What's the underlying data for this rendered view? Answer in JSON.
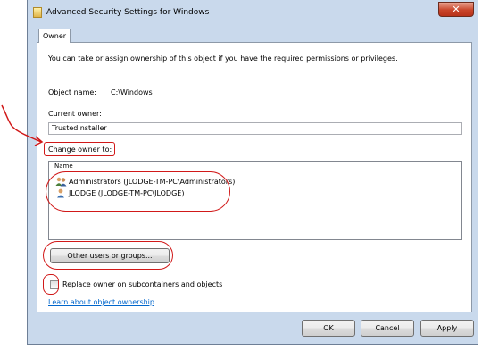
{
  "window": {
    "title": "Advanced Security Settings for Windows",
    "close_glyph": "✕"
  },
  "tabs": [
    {
      "label": "Owner"
    }
  ],
  "owner": {
    "intro": "You can take or assign ownership of this object if you have the required permissions or privileges.",
    "object_name_label": "Object name:",
    "object_name_value": "C:\\Windows",
    "current_owner_label": "Current owner:",
    "current_owner_value": "TrustedInstaller",
    "change_owner_label": "Change owner to:",
    "list_header": "Name",
    "list_items": [
      {
        "label": "Administrators (JLODGE-TM-PC\\Administrators)",
        "icon": "group-users-icon"
      },
      {
        "label": "JLODGE (JLODGE-TM-PC\\JLODGE)",
        "icon": "user-icon"
      }
    ],
    "other_users_button": "Other users or groups...",
    "replace_checkbox_label": "Replace owner on subcontainers and objects",
    "replace_checked": false,
    "learn_link": "Learn about object ownership"
  },
  "buttons": {
    "ok": "OK",
    "cancel": "Cancel",
    "apply": "Apply"
  },
  "colors": {
    "annotation": "#d11919",
    "link": "#0066cc"
  }
}
